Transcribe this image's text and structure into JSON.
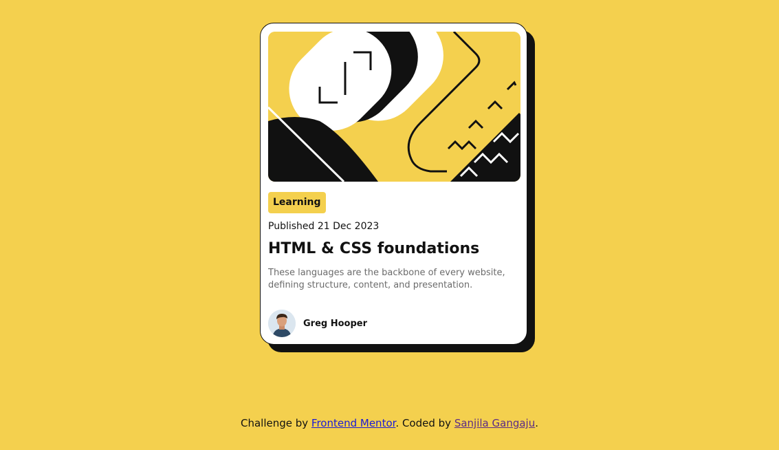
{
  "card": {
    "tag": "Learning",
    "published": "Published 21 Dec 2023",
    "title": "HTML & CSS foundations",
    "description": "These languages are the backbone of every website, defining structure, content, and presentation.",
    "author": "Greg Hooper"
  },
  "footer": {
    "prefix": "Challenge by ",
    "challenge_link": "Frontend Mentor",
    "middle": ". Coded by ",
    "coder_link": "Sanjila Gangaju",
    "suffix": "."
  },
  "colors": {
    "background": "#F4D04E",
    "card": "#FFFFFF",
    "ink": "#111111",
    "muted_text": "#6B6B6B"
  }
}
